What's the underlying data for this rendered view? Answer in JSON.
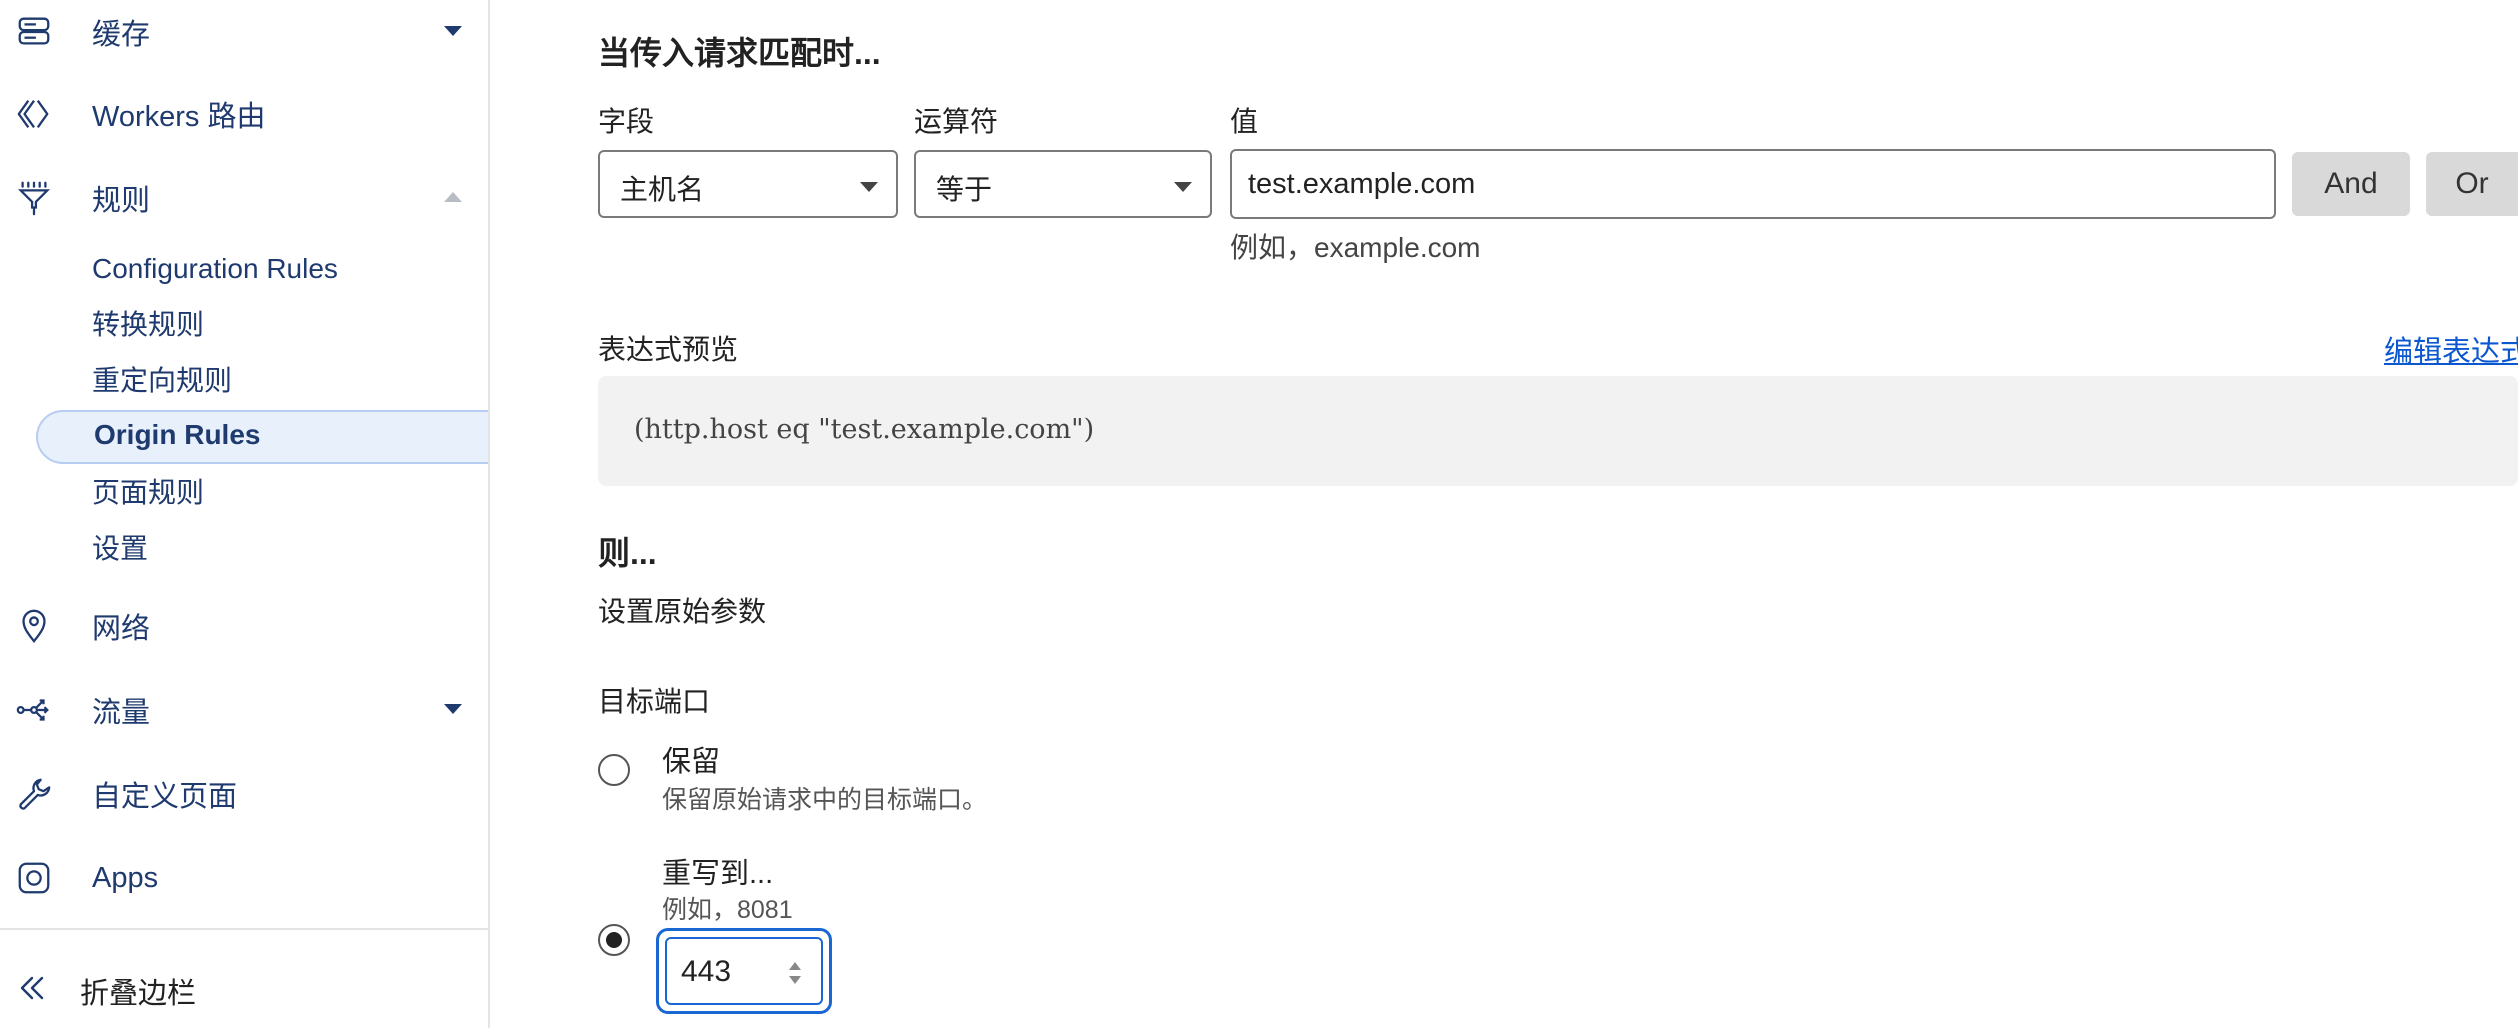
{
  "sidebar": {
    "cache_label": "缓存",
    "workers_label": "Workers 路由",
    "rules_label": "规则",
    "rules_subitems": [
      "Configuration Rules",
      "转换规则",
      "重定向规则",
      "Origin Rules",
      "页面规则",
      "设置"
    ],
    "network_label": "网络",
    "traffic_label": "流量",
    "custom_pages_label": "自定义页面",
    "apps_label": "Apps",
    "collapse_label": "折叠边栏"
  },
  "match": {
    "title": "当传入请求匹配时...",
    "field_label": "字段",
    "operator_label": "运算符",
    "value_label": "值",
    "field_value": "主机名",
    "operator_value": "等于",
    "value_input": "test.example.com",
    "value_hint": "例如，example.com",
    "and_label": "And",
    "or_label": "Or"
  },
  "expression": {
    "label": "表达式预览",
    "edit_link": "编辑表达式",
    "preview": "(http.host eq \"test.example.com\")"
  },
  "then": {
    "title": "则...",
    "subtitle": "设置原始参数",
    "port_label": "目标端口",
    "keep_label": "保留",
    "keep_desc": "保留原始请求中的目标端口。",
    "rewrite_label": "重写到...",
    "rewrite_hint": "例如，8081",
    "port_value": "443"
  },
  "colors": {
    "accent": "#1967d2",
    "nav_text": "#1f3a6e",
    "active_bg": "#e8f0fc"
  },
  "icons": [
    "cache-icon",
    "workers-icon",
    "rules-icon",
    "network-icon",
    "traffic-icon",
    "wrench-icon",
    "apps-icon",
    "collapse-icon"
  ]
}
